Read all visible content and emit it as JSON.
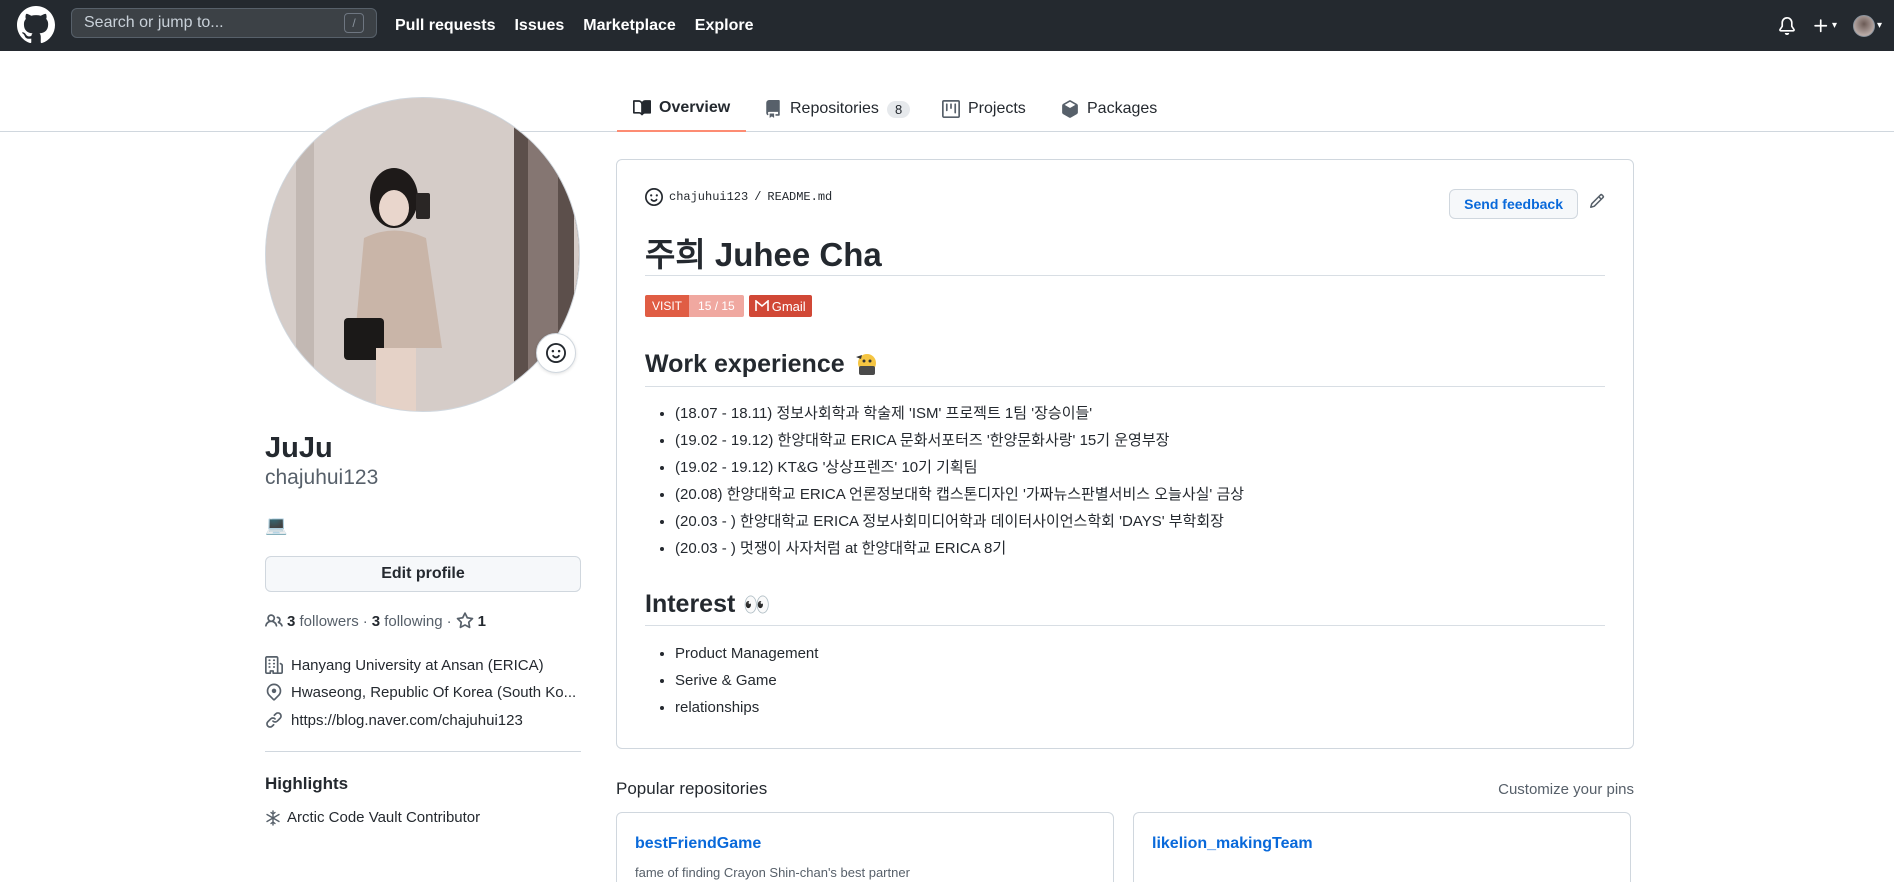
{
  "header": {
    "search_placeholder": "Search or jump to...",
    "search_shortcut": "/",
    "nav": [
      "Pull requests",
      "Issues",
      "Marketplace",
      "Explore"
    ]
  },
  "tabs": [
    {
      "label": "Overview",
      "icon": "book-icon",
      "active": true
    },
    {
      "label": "Repositories",
      "icon": "repo-icon",
      "count": "8"
    },
    {
      "label": "Projects",
      "icon": "project-icon"
    },
    {
      "label": "Packages",
      "icon": "package-icon"
    }
  ],
  "profile": {
    "name": "JuJu",
    "login": "chajuhui123",
    "status_emoji": "💻",
    "edit_label": "Edit profile",
    "followers_count": "3",
    "followers_label": "followers",
    "following_count": "3",
    "following_label": "following",
    "stars_count": "1",
    "organization": "Hanyang University at Ansan (ERICA)",
    "location": "Hwaseong, Republic Of Korea (South Ko...",
    "website": "https://blog.naver.com/chajuhui123",
    "highlights_title": "Highlights",
    "highlight": "Arctic Code Vault Contributor"
  },
  "readme": {
    "owner": "chajuhui123",
    "separator": "/",
    "file": "README.md",
    "feedback_label": "Send feedback",
    "title": "주희 Juhee Cha",
    "badge_visit_label": "VISIT",
    "badge_visit_value": "15 / 15",
    "badge_gmail_label": "Gmail",
    "work_title": "Work experience",
    "work_items": [
      "(18.07 - 18.11) 정보사회학과 학술제 'ISM' 프로젝트 1팀 '장승이들'",
      "(19.02 - 19.12) 한양대학교 ERICA 문화서포터즈 '한양문화사랑' 15기 운영부장",
      "(19.02 - 19.12) KT&G '상상프렌즈' 10기 기획팀",
      "(20.08) 한양대학교 ERICA 언론정보대학 캡스톤디자인 '가짜뉴스판별서비스 오늘사실' 금상",
      "(20.03 - ) 한양대학교 ERICA 정보사회미디어학과 데이터사이언스학회 'DAYS' 부학회장",
      "(20.03 - ) 멋쟁이 사자처럼 at 한양대학교 ERICA 8기"
    ],
    "interest_title": "Interest",
    "interest_emoji": "👀",
    "interest_items": [
      "Product Management",
      "Serive & Game",
      "relationships"
    ]
  },
  "popular": {
    "title": "Popular repositories",
    "customize_label": "Customize your pins",
    "repos": [
      {
        "name": "bestFriendGame",
        "description": "fame of finding Crayon Shin-chan's best partner"
      },
      {
        "name": "likelion_makingTeam",
        "description": ""
      }
    ]
  }
}
